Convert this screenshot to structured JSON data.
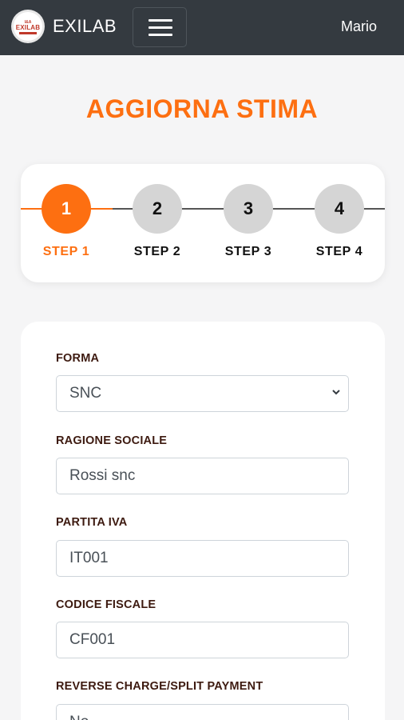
{
  "navbar": {
    "logo_small": "I&A",
    "logo_text": "EXILAB",
    "brand": "EXILAB",
    "menu_icon": "hamburger-icon",
    "user": "Mario"
  },
  "page": {
    "title": "AGGIORNA STIMA"
  },
  "stepper": {
    "steps": [
      {
        "number": "1",
        "label": "STEP 1",
        "active": true
      },
      {
        "number": "2",
        "label": "STEP 2",
        "active": false
      },
      {
        "number": "3",
        "label": "STEP 3",
        "active": false
      },
      {
        "number": "4",
        "label": "STEP 4",
        "active": false
      }
    ]
  },
  "form": {
    "forma": {
      "label": "FORMA",
      "value": "SNC"
    },
    "ragione_sociale": {
      "label": "RAGIONE SOCIALE",
      "value": "Rossi snc"
    },
    "partita_iva": {
      "label": "PARTITA IVA",
      "value": "IT001"
    },
    "codice_fiscale": {
      "label": "CODICE FISCALE",
      "value": "CF001"
    },
    "reverse_charge": {
      "label": "REVERSE CHARGE/SPLIT PAYMENT",
      "value": "No"
    }
  },
  "colors": {
    "accent": "#fd6f11",
    "navbar": "#343a40",
    "background": "#f5f5f6",
    "inactive_step": "#d5d5d5"
  }
}
